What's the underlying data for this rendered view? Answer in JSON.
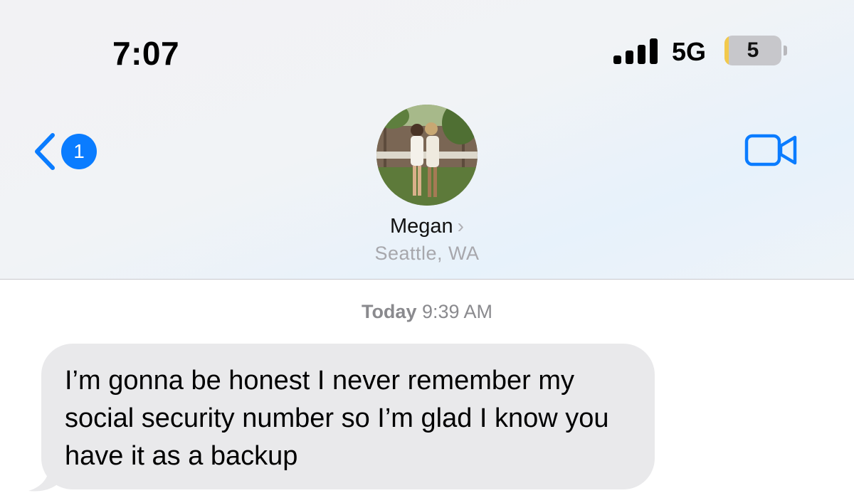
{
  "status_bar": {
    "time": "7:07",
    "network": "5G",
    "battery_level": "5",
    "battery_percent": 5
  },
  "nav": {
    "back_badge_count": "1",
    "back_icon": "chevron-left-icon",
    "video_icon": "video-camera-icon",
    "accent_color": "#0a7cff"
  },
  "contact": {
    "name": "Megan",
    "location": "Seattle, WA",
    "chevron": "›"
  },
  "conversation": {
    "timestamp_day": "Today",
    "timestamp_time": "9:39 AM",
    "messages": [
      {
        "direction": "incoming",
        "text": "I’m gonna be honest I never remember my social security number so I’m glad I know you have it as a backup"
      }
    ]
  }
}
